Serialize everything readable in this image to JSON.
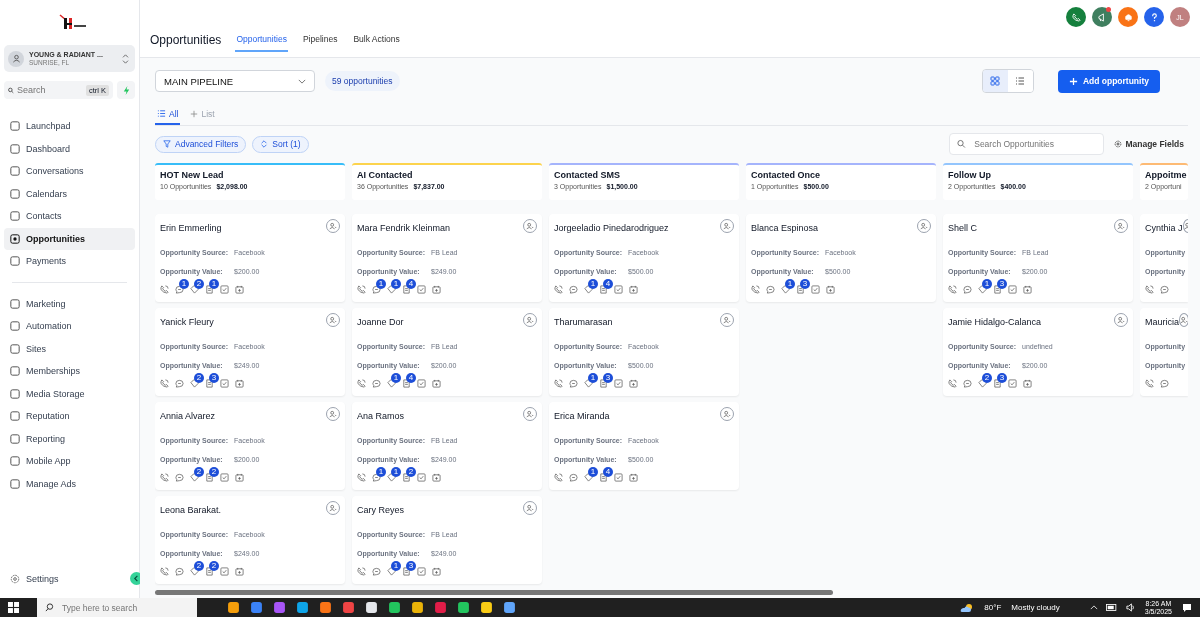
{
  "sidebar": {
    "account": {
      "name": "YOUNG & RADIANT ...",
      "location": "SUNRISE, FL"
    },
    "search": {
      "placeholder": "Search",
      "shortcut": "ctrl K"
    },
    "groups": [
      [
        {
          "label": "Launchpad",
          "selected": false
        },
        {
          "label": "Dashboard",
          "selected": false
        },
        {
          "label": "Conversations",
          "selected": false
        },
        {
          "label": "Calendars",
          "selected": false
        },
        {
          "label": "Contacts",
          "selected": false
        },
        {
          "label": "Opportunities",
          "selected": true
        },
        {
          "label": "Payments",
          "selected": false
        }
      ],
      [
        {
          "label": "Marketing",
          "selected": false
        },
        {
          "label": "Automation",
          "selected": false
        },
        {
          "label": "Sites",
          "selected": false
        },
        {
          "label": "Memberships",
          "selected": false
        },
        {
          "label": "Media Storage",
          "selected": false
        },
        {
          "label": "Reputation",
          "selected": false
        },
        {
          "label": "Reporting",
          "selected": false
        },
        {
          "label": "Mobile App",
          "selected": false
        },
        {
          "label": "Manage Ads",
          "selected": false
        }
      ]
    ],
    "settings": "Settings"
  },
  "header": {
    "avatar": "JL",
    "title": "Opportunities",
    "tabs": [
      {
        "label": "Opportunities",
        "selected": true
      },
      {
        "label": "Pipelines",
        "selected": false
      },
      {
        "label": "Bulk Actions",
        "selected": false
      }
    ]
  },
  "toolbar": {
    "pipeline": "MAIN PIPELINE",
    "count": "59 opportunities",
    "views": [
      {
        "kind": "grid",
        "selected": true
      },
      {
        "kind": "list",
        "selected": false
      }
    ],
    "add_button": "Add opportunity",
    "subtabs": [
      {
        "label": "All",
        "selected": true
      },
      {
        "label": "List",
        "selected": false
      }
    ],
    "filters": [
      "Advanced Filters",
      "Sort (1)"
    ],
    "search_placeholder": "Search Opportunities",
    "manage_fields": "Manage Fields"
  },
  "columns": [
    {
      "name": "HOT New Lead",
      "count": "10 Opportunities",
      "total": "$2,098.00",
      "color": "#38bdf8",
      "cards": [
        {
          "name": "Erin Emmerling",
          "source_label": "Opportunity Source:",
          "source": "Facebook",
          "value_label": "Opportunity Value:",
          "value": "$200.00",
          "counts": {
            "messages": "1",
            "tags": "2",
            "notes": "1"
          }
        },
        {
          "name": "Yanick Fleury",
          "source_label": "Opportunity Source:",
          "source": "Facebook",
          "value_label": "Opportunity Value:",
          "value": "$249.00",
          "counts": {
            "tags": "2",
            "notes": "3"
          }
        },
        {
          "name": "Annia Alvarez",
          "source_label": "Opportunity Source:",
          "source": "Facebook",
          "value_label": "Opportunity Value:",
          "value": "$200.00",
          "counts": {
            "tags": "2",
            "notes": "2"
          }
        },
        {
          "name": "Leona Barakat.",
          "source_label": "Opportunity Source:",
          "source": "Facebook",
          "value_label": "Opportunity Value:",
          "value": "$249.00",
          "counts": {
            "tags": "2",
            "notes": "2"
          }
        }
      ]
    },
    {
      "name": "AI Contacted",
      "count": "36 Opportunities",
      "total": "$7,837.00",
      "color": "#fcd34d",
      "cards": [
        {
          "name": "Mara Fendrik Kleinman",
          "source_label": "Opportunity Source:",
          "source": "FB Lead",
          "value_label": "Opportunity Value:",
          "value": "$249.00",
          "counts": {
            "messages": "1",
            "tags": "1",
            "notes": "4"
          }
        },
        {
          "name": "Joanne Dor",
          "source_label": "Opportunity Source:",
          "source": "FB Lead",
          "value_label": "Opportunity Value:",
          "value": "$200.00",
          "counts": {
            "tags": "1",
            "notes": "4"
          }
        },
        {
          "name": "Ana Ramos",
          "source_label": "Opportunity Source:",
          "source": "FB Lead",
          "value_label": "Opportunity Value:",
          "value": "$249.00",
          "counts": {
            "messages": "1",
            "tags": "1",
            "notes": "2"
          }
        },
        {
          "name": "Cary Reyes",
          "source_label": "Opportunity Source:",
          "source": "FB Lead",
          "value_label": "Opportunity Value:",
          "value": "$249.00",
          "counts": {
            "tags": "1",
            "notes": "3"
          }
        }
      ]
    },
    {
      "name": "Contacted SMS",
      "count": "3 Opportunities",
      "total": "$1,500.00",
      "color": "#a5b4fc",
      "cards": [
        {
          "name": "Jorgeeladio Pinedarodriguez",
          "source_label": "Opportunity Source:",
          "source": "Facebook",
          "value_label": "Opportunity Value:",
          "value": "$500.00",
          "counts": {
            "tags": "1",
            "notes": "4"
          }
        },
        {
          "name": "Tharumarasan",
          "source_label": "Opportunity Source:",
          "source": "Facebook",
          "value_label": "Opportunity Value:",
          "value": "$500.00",
          "counts": {
            "tags": "1",
            "notes": "3"
          }
        },
        {
          "name": "Erica Miranda",
          "source_label": "Opportunity Source:",
          "source": "Facebook",
          "value_label": "Opportunity Value:",
          "value": "$500.00",
          "counts": {
            "tags": "1",
            "notes": "4"
          }
        }
      ]
    },
    {
      "name": "Contacted Once",
      "count": "1 Opportunities",
      "total": "$500.00",
      "color": "#a5b4fc",
      "cards": [
        {
          "name": "Blanca Espinosa",
          "source_label": "Opportunity Source:",
          "source": "Facebook",
          "value_label": "Opportunity Value:",
          "value": "$500.00",
          "counts": {
            "tags": "1",
            "notes": "3"
          }
        }
      ]
    },
    {
      "name": "Follow Up",
      "count": "2 Opportunities",
      "total": "$400.00",
      "color": "#93c5fd",
      "cards": [
        {
          "name": "Shell C",
          "source_label": "Opportunity Source:",
          "source": "FB Lead",
          "value_label": "Opportunity Value:",
          "value": "$200.00",
          "counts": {
            "tags": "1",
            "notes": "3"
          }
        },
        {
          "name": "Jamie Hidalgo-Calanca",
          "source_label": "Opportunity Source:",
          "source": "undefined",
          "value_label": "Opportunity Value:",
          "value": "$200.00",
          "counts": {
            "tags": "2",
            "notes": "3"
          }
        }
      ]
    },
    {
      "name": "Appoitme",
      "count": "2 Opportuni",
      "color": "#fdba74",
      "cards": [
        {
          "name": "Cynthia J",
          "source_label": "Opportunity",
          "value_label": "Opportunity"
        },
        {
          "name": "Mauricia",
          "source_label": "Opportunity",
          "value_label": "Opportunity"
        }
      ]
    }
  ],
  "taskbar": {
    "search_placeholder": "Type here to search",
    "weather": "80°F",
    "weather_text": "Mostly cloudy",
    "time": "8:26 AM",
    "date": "3/5/2025"
  }
}
